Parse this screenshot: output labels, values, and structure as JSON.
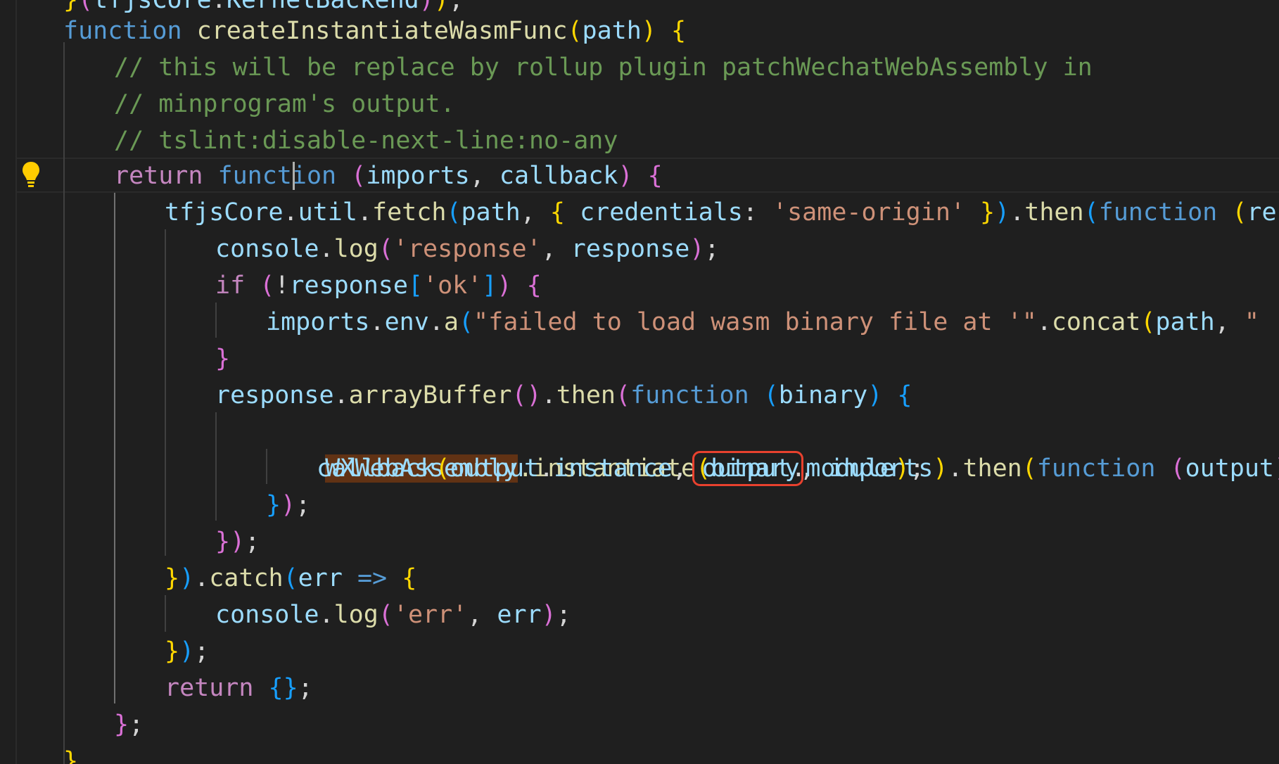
{
  "editor": {
    "lines": [
      [
        [
          "b1",
          "}"
        ],
        [
          "b2",
          "("
        ],
        [
          "id",
          "tfjsCore"
        ],
        [
          "pl",
          "."
        ],
        [
          "id",
          "KernelBackend"
        ],
        [
          "b2",
          ")"
        ],
        [
          "b1",
          ")"
        ],
        [
          "pl",
          ";"
        ]
      ],
      [
        [
          "kw",
          "function "
        ],
        [
          "fn",
          "createInstantiateWasmFunc"
        ],
        [
          "b1",
          "("
        ],
        [
          "id",
          "path"
        ],
        [
          "b1",
          ")"
        ],
        [
          "pl",
          " "
        ],
        [
          "b1",
          "{"
        ]
      ],
      [
        [
          "cm",
          "// this will be replace by rollup plugin patchWechatWebAssembly in"
        ]
      ],
      [
        [
          "cm",
          "// minprogram's output."
        ]
      ],
      [
        [
          "cm",
          "// tslint:disable-next-line:no-any"
        ]
      ],
      [
        [
          "kwc",
          "return "
        ],
        [
          "kw",
          "function "
        ],
        [
          "b2",
          "("
        ],
        [
          "id",
          "imports"
        ],
        [
          "pl",
          ", "
        ],
        [
          "id",
          "callback"
        ],
        [
          "b2",
          ")"
        ],
        [
          "pl",
          " "
        ],
        [
          "b2",
          "{"
        ]
      ],
      [
        [
          "id",
          "tfjsCore"
        ],
        [
          "pl",
          "."
        ],
        [
          "id",
          "util"
        ],
        [
          "pl",
          "."
        ],
        [
          "fn",
          "fetch"
        ],
        [
          "b3",
          "("
        ],
        [
          "id",
          "path"
        ],
        [
          "pl",
          ", "
        ],
        [
          "b1",
          "{"
        ],
        [
          "pl",
          " "
        ],
        [
          "id",
          "credentials"
        ],
        [
          "pl",
          ": "
        ],
        [
          "str",
          "'same-origin'"
        ],
        [
          "pl",
          " "
        ],
        [
          "b1",
          "}"
        ],
        [
          "b3",
          ")"
        ],
        [
          "pl",
          "."
        ],
        [
          "fn",
          "then"
        ],
        [
          "b3",
          "("
        ],
        [
          "kw",
          "function "
        ],
        [
          "b1",
          "("
        ],
        [
          "id",
          "re"
        ]
      ],
      [
        [
          "id",
          "console"
        ],
        [
          "pl",
          "."
        ],
        [
          "fn",
          "log"
        ],
        [
          "b2",
          "("
        ],
        [
          "str",
          "'response'"
        ],
        [
          "pl",
          ", "
        ],
        [
          "id",
          "response"
        ],
        [
          "b2",
          ")"
        ],
        [
          "pl",
          ";"
        ]
      ],
      [
        [
          "kwc",
          "if "
        ],
        [
          "b2",
          "("
        ],
        [
          "pl",
          "!"
        ],
        [
          "id",
          "response"
        ],
        [
          "b3",
          "["
        ],
        [
          "str",
          "'ok'"
        ],
        [
          "b3",
          "]"
        ],
        [
          "b2",
          ")"
        ],
        [
          "pl",
          " "
        ],
        [
          "b2",
          "{"
        ]
      ],
      [
        [
          "id",
          "imports"
        ],
        [
          "pl",
          "."
        ],
        [
          "id",
          "env"
        ],
        [
          "pl",
          "."
        ],
        [
          "fn",
          "a"
        ],
        [
          "b3",
          "("
        ],
        [
          "str",
          "\"failed to load wasm binary file at '\""
        ],
        [
          "pl",
          "."
        ],
        [
          "fn",
          "concat"
        ],
        [
          "b1",
          "("
        ],
        [
          "id",
          "path"
        ],
        [
          "pl",
          ", "
        ],
        [
          "str",
          "\""
        ]
      ],
      [
        [
          "b2",
          "}"
        ]
      ],
      [
        [
          "id",
          "response"
        ],
        [
          "pl",
          "."
        ],
        [
          "fn",
          "arrayBuffer"
        ],
        [
          "b2",
          "()"
        ],
        [
          "pl",
          "."
        ],
        [
          "fn",
          "then"
        ],
        [
          "b2",
          "("
        ],
        [
          "kw",
          "function "
        ],
        [
          "b3",
          "("
        ],
        [
          "id",
          "binary"
        ],
        [
          "b3",
          ")"
        ],
        [
          "pl",
          " "
        ],
        [
          "b3",
          "{"
        ]
      ],
      [
        [
          "id",
          "callback"
        ],
        [
          "b1",
          "("
        ],
        [
          "id",
          "output"
        ],
        [
          "pl",
          "."
        ],
        [
          "id",
          "instance"
        ],
        [
          "pl",
          ", "
        ],
        [
          "id",
          "output"
        ],
        [
          "pl",
          "."
        ],
        [
          "id",
          "module"
        ],
        [
          "b1",
          ")"
        ],
        [
          "pl",
          ";"
        ]
      ],
      [
        [
          "b3",
          "}"
        ],
        [
          "b2",
          ")"
        ],
        [
          "pl",
          ";"
        ]
      ],
      [
        [
          "b2",
          "}"
        ],
        [
          "b2",
          ")"
        ],
        [
          "pl",
          ";"
        ]
      ],
      [
        [
          "b1",
          "}"
        ],
        [
          "b3",
          ")"
        ],
        [
          "pl",
          "."
        ],
        [
          "fn",
          "catch"
        ],
        [
          "b3",
          "("
        ],
        [
          "id",
          "err"
        ],
        [
          "pl",
          " "
        ],
        [
          "kw",
          "=>"
        ],
        [
          "pl",
          " "
        ],
        [
          "b1",
          "{"
        ]
      ],
      [
        [
          "id",
          "console"
        ],
        [
          "pl",
          "."
        ],
        [
          "fn",
          "log"
        ],
        [
          "b2",
          "("
        ],
        [
          "str",
          "'err'"
        ],
        [
          "pl",
          ", "
        ],
        [
          "id",
          "err"
        ],
        [
          "b2",
          ")"
        ],
        [
          "pl",
          ";"
        ]
      ],
      [
        [
          "b1",
          "}"
        ],
        [
          "b3",
          ")"
        ],
        [
          "pl",
          ";"
        ]
      ],
      [
        [
          "kwc",
          "return "
        ],
        [
          "b3",
          "{}"
        ],
        [
          "pl",
          ";"
        ]
      ],
      [
        [
          "b2",
          "}"
        ],
        [
          "pl",
          ";"
        ]
      ],
      [
        [
          "b1",
          "}"
        ]
      ]
    ],
    "instantiate_line": {
      "ident": "WXWebAssembly",
      "method": ".instantiate",
      "open_paren": "(",
      "arg": "binary",
      "rest": [
        [
          "pl",
          ", "
        ],
        [
          "id",
          "imports"
        ],
        [
          "b1",
          ")"
        ],
        [
          "pl",
          "."
        ],
        [
          "fn",
          "then"
        ],
        [
          "b1",
          "("
        ],
        [
          "kw",
          "function "
        ],
        [
          "b2",
          "("
        ],
        [
          "id",
          "output"
        ],
        [
          "b2",
          ")"
        ],
        [
          "pl",
          " "
        ],
        [
          "b2",
          "{"
        ]
      ]
    },
    "colors": {
      "keyword": "#569cd6",
      "control_keyword": "#c586c0",
      "function": "#dcdcaa",
      "identifier": "#9cdcfe",
      "string": "#ce9178",
      "comment": "#6a9955",
      "bracket_gold": "#ffd700",
      "bracket_orchid": "#da70d6",
      "bracket_blue": "#179fff",
      "find_highlight": "#613214",
      "annotation_box": "#e8412e"
    },
    "icons": {
      "lightbulb": "lightbulb-icon"
    }
  }
}
